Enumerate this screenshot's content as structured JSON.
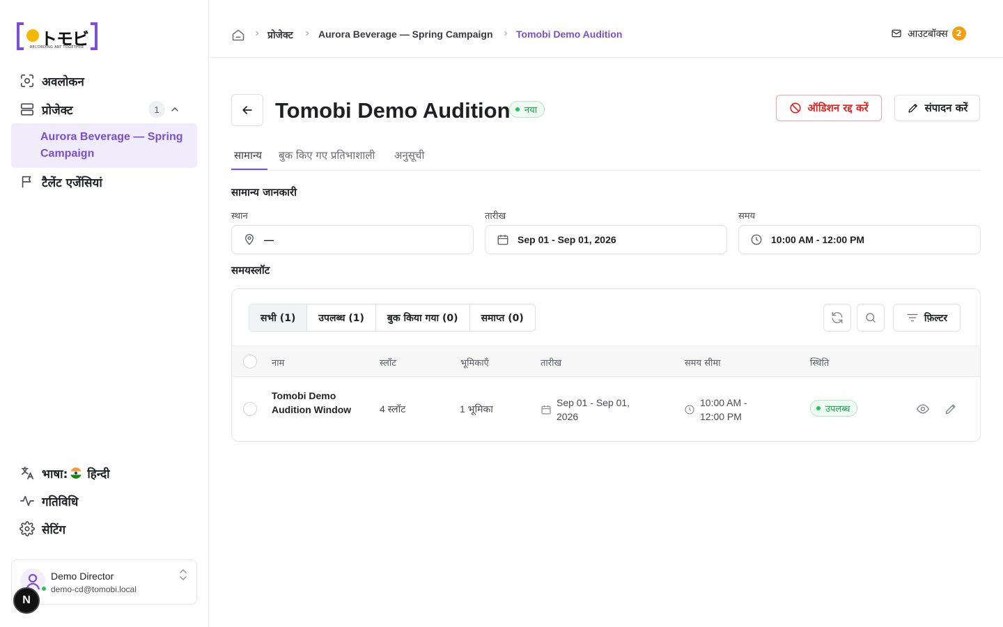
{
  "brand": {
    "mark": "トモビ",
    "tagline": "RECORDING ART TOGETHER",
    "accent": "#7c4ddb"
  },
  "sidebar": {
    "items": [
      {
        "label": "अवलोकन",
        "icon": "scan-icon"
      },
      {
        "label": "प्रोजेक्ट",
        "icon": "stack-icon",
        "count": "1"
      },
      {
        "label": "टैलेंट एजेंसियां",
        "icon": "flag-icon"
      }
    ],
    "sub_item": "Aurora Beverage — Spring Campaign",
    "language_label": "भाषा:",
    "language_value": "हिन्दी",
    "activity": "गतिविधि",
    "settings": "सेटिंग"
  },
  "user": {
    "name": "Demo Director",
    "email": "demo-cd@tomobi.local",
    "dev_badge": "N"
  },
  "breadcrumb": {
    "items": [
      "प्रोजेक्ट",
      "Aurora Beverage — Spring Campaign",
      "Tomobi Demo Audition"
    ]
  },
  "outbox": {
    "label": "आउटबॉक्स",
    "count": "2"
  },
  "page": {
    "title": "Tomobi Demo Audition",
    "status": "नया",
    "cancel_label": "ऑडिशन रद्द करें",
    "edit_label": "संपादन करें"
  },
  "tabs": [
    "सामान्य",
    "बुक किए गए प्रतिभाशाली",
    "अनुसूची"
  ],
  "general": {
    "section_title": "सामान्य जानकारी",
    "location_label": "स्थान",
    "location_value": "—",
    "date_label": "तारीख",
    "date_value": "Sep 01 - Sep 01, 2026",
    "time_label": "समय",
    "time_value": "10:00 AM - 12:00 PM"
  },
  "timeslots": {
    "section_title": "समयस्लॉट",
    "segments": [
      "सभी (1)",
      "उपलब्ध (1)",
      "बुक किया गया (0)",
      "समाप्त (0)"
    ],
    "filter_label": "फ़िल्टर",
    "columns": [
      "नाम",
      "स्लॉट",
      "भूमिकाएँ",
      "तारीख",
      "समय सीमा",
      "स्थिति"
    ],
    "rows": [
      {
        "name": "Tomobi Demo Audition Window",
        "slots": "4 स्लॉट",
        "roles": "1 भूमिका",
        "date": "Sep 01 - Sep 01, 2026",
        "time": "10:00 AM - 12:00 PM",
        "status": "उपलब्ध"
      }
    ]
  }
}
